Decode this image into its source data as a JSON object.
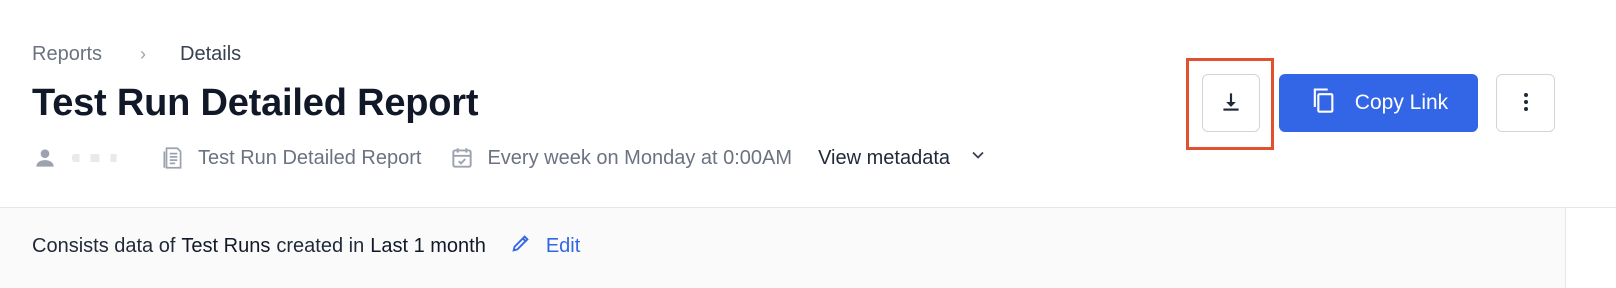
{
  "breadcrumb": {
    "parent": "Reports",
    "separator": "›",
    "current": "Details"
  },
  "page_title": "Test Run Detailed Report",
  "meta": {
    "report_name": "Test Run Detailed Report",
    "schedule": "Every week on Monday at 0:00AM",
    "view_metadata_label": "View metadata"
  },
  "actions": {
    "copy_link_label": "Copy Link"
  },
  "summary": {
    "prefix": "Consists data of",
    "entity": "Test Runs",
    "middle": "created in",
    "period": "Last 1 month",
    "edit_label": "Edit"
  },
  "colors": {
    "primary": "#3366e6",
    "highlight": "#e0522f"
  },
  "icons": {
    "owner": "person-icon",
    "report": "document-icon",
    "schedule": "calendar-check-icon",
    "expand": "chevron-down-icon",
    "download": "download-icon",
    "copy": "copy-icon",
    "more": "more-vertical-icon",
    "edit": "pencil-icon"
  }
}
